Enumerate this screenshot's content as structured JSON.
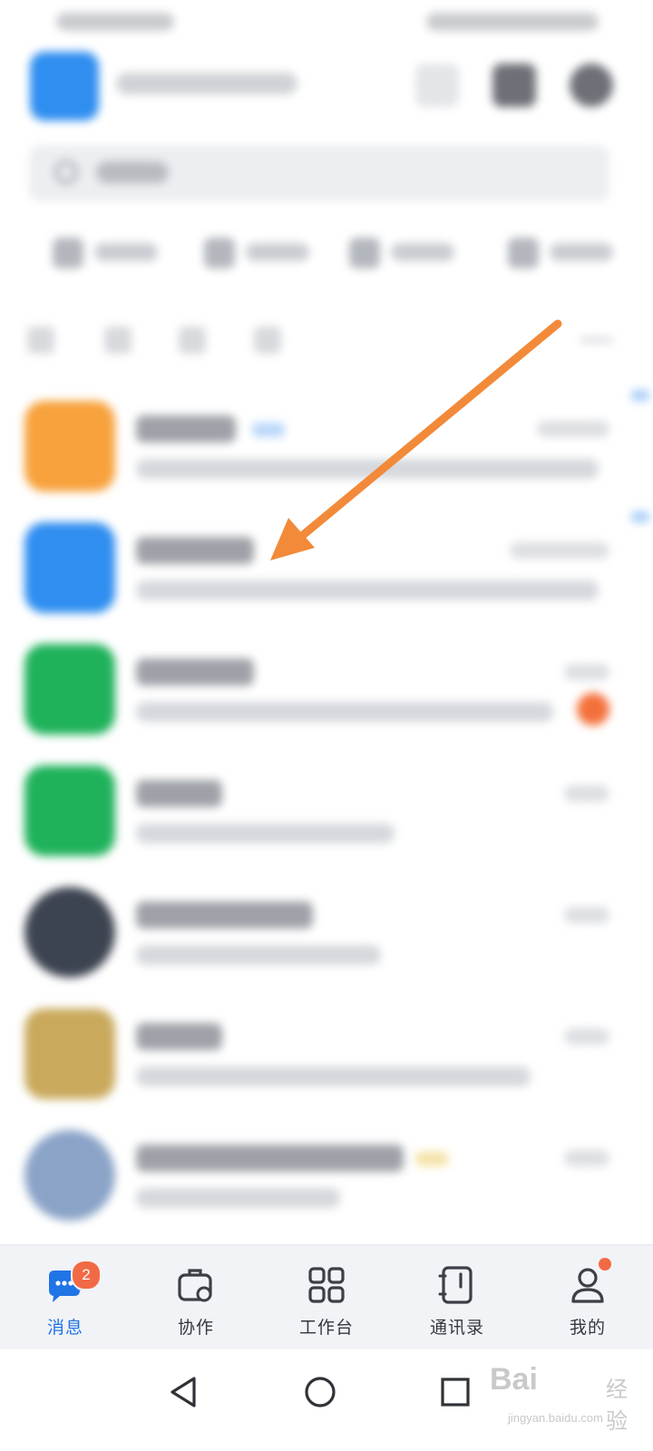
{
  "tabs": [
    {
      "label": "消息",
      "icon": "message-icon",
      "active": true,
      "badge": "2"
    },
    {
      "label": "协作",
      "icon": "briefcase-icon",
      "active": false
    },
    {
      "label": "工作台",
      "icon": "apps-grid-icon",
      "active": false
    },
    {
      "label": "通讯录",
      "icon": "contacts-book-icon",
      "active": false
    },
    {
      "label": "我的",
      "icon": "person-icon",
      "active": false,
      "dot": true
    }
  ],
  "system_nav": [
    "back-icon",
    "home-icon",
    "recents-icon"
  ],
  "watermark": {
    "brand": "Bai",
    "brand_suffix": "经验",
    "url": "jingyan.baidu.com"
  },
  "colors": {
    "accent": "#1f74e6",
    "badge": "#f26a45",
    "annotation_arrow": "#f28a3a",
    "avatar_orange": "#f7a23c",
    "avatar_blue": "#2f8ef0",
    "avatar_green": "#1fb25a"
  }
}
